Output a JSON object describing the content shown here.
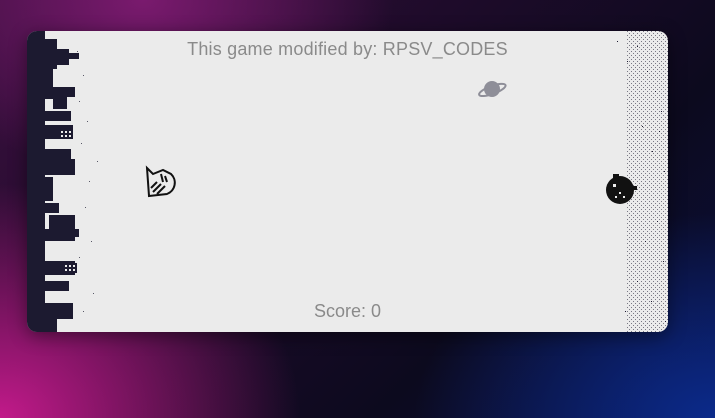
{
  "game": {
    "credit_text": "This game modified by: RPSV_CODES",
    "score_text": "Score: 0"
  },
  "sprites": {
    "player": "cat-player-icon",
    "enemy": "bomb-bird-icon",
    "planet": "planet-icon"
  },
  "colors": {
    "background": "#ebebeb",
    "text": "#8a8a8a",
    "ink": "#1a1a2e"
  }
}
